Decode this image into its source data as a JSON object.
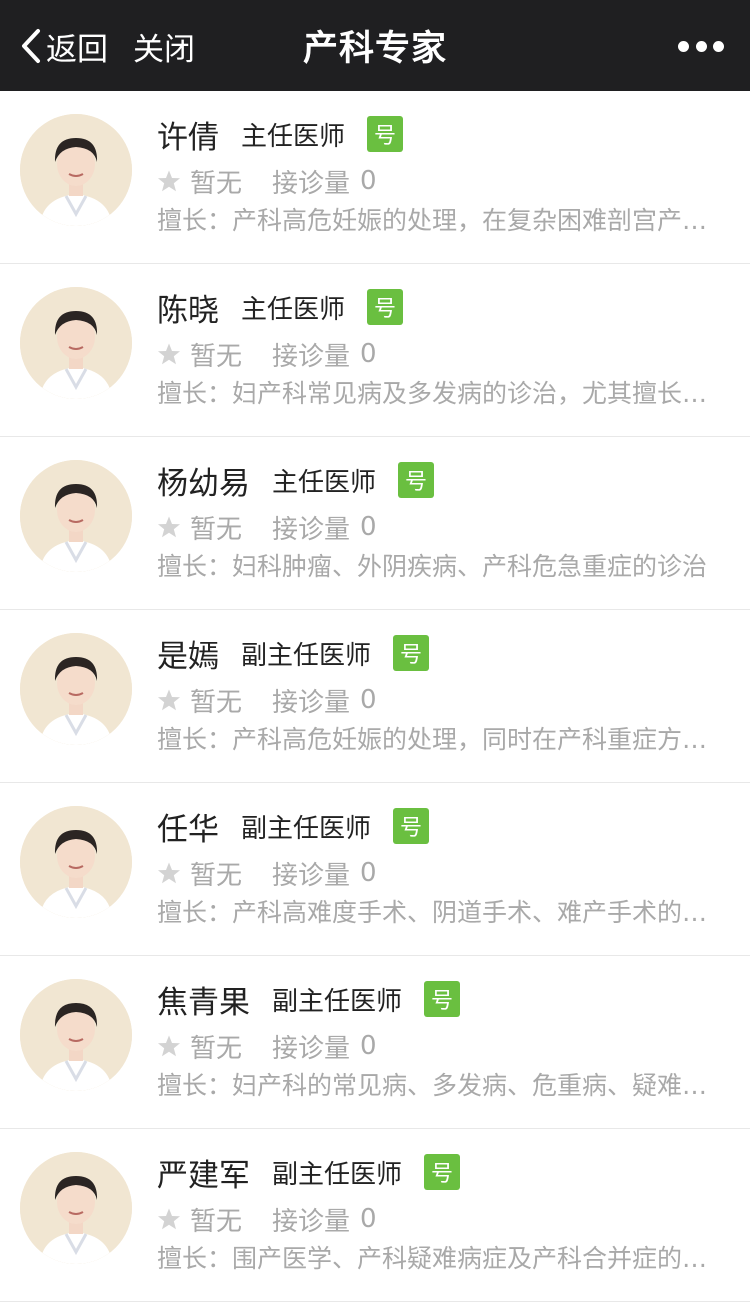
{
  "nav": {
    "back_label": "返回",
    "close_label": "关闭",
    "title": "产科专家",
    "more_icon": "more-dots-icon"
  },
  "colors": {
    "navbar_bg": "#1f1f21",
    "badge_green": "#6abf40",
    "muted_text": "#a9a9a9",
    "primary_text": "#222222"
  },
  "doctors": [
    {
      "name": "许倩",
      "title": "主任医师",
      "badge": "号",
      "rating": "暂无",
      "count_label": "接诊量",
      "count": "0",
      "desc": "擅长：产科高危妊娠的处理，在复杂困难剖宫产手术方面经验丰富"
    },
    {
      "name": "陈晓",
      "title": "主任医师",
      "badge": "号",
      "rating": "暂无",
      "count_label": "接诊量",
      "count": "0",
      "desc": "擅长：妇产科常见病及多发病的诊治，尤其擅长产科危重症的处理"
    },
    {
      "name": "杨幼易",
      "title": "主任医师",
      "badge": "号",
      "rating": "暂无",
      "count_label": "接诊量",
      "count": "0",
      "desc": "擅长：妇科肿瘤、外阴疾病、产科危急重症的诊治"
    },
    {
      "name": "是嫣",
      "title": "副主任医师",
      "badge": "号",
      "rating": "暂无",
      "count_label": "接诊量",
      "count": "0",
      "desc": "擅长：产科高危妊娠的处理，同时在产科重症方面经验丰富"
    },
    {
      "name": "任华",
      "title": "副主任医师",
      "badge": "号",
      "rating": "暂无",
      "count_label": "接诊量",
      "count": "0",
      "desc": "擅长：产科高难度手术、阴道手术、难产手术的处理"
    },
    {
      "name": "焦青果",
      "title": "副主任医师",
      "badge": "号",
      "rating": "暂无",
      "count_label": "接诊量",
      "count": "0",
      "desc": "擅长：妇产科的常见病、多发病、危重病、疑难病的诊治"
    },
    {
      "name": "严建军",
      "title": "副主任医师",
      "badge": "号",
      "rating": "暂无",
      "count_label": "接诊量",
      "count": "0",
      "desc": "擅长：围产医学、产科疑难病症及产科合并症的诊治"
    }
  ]
}
